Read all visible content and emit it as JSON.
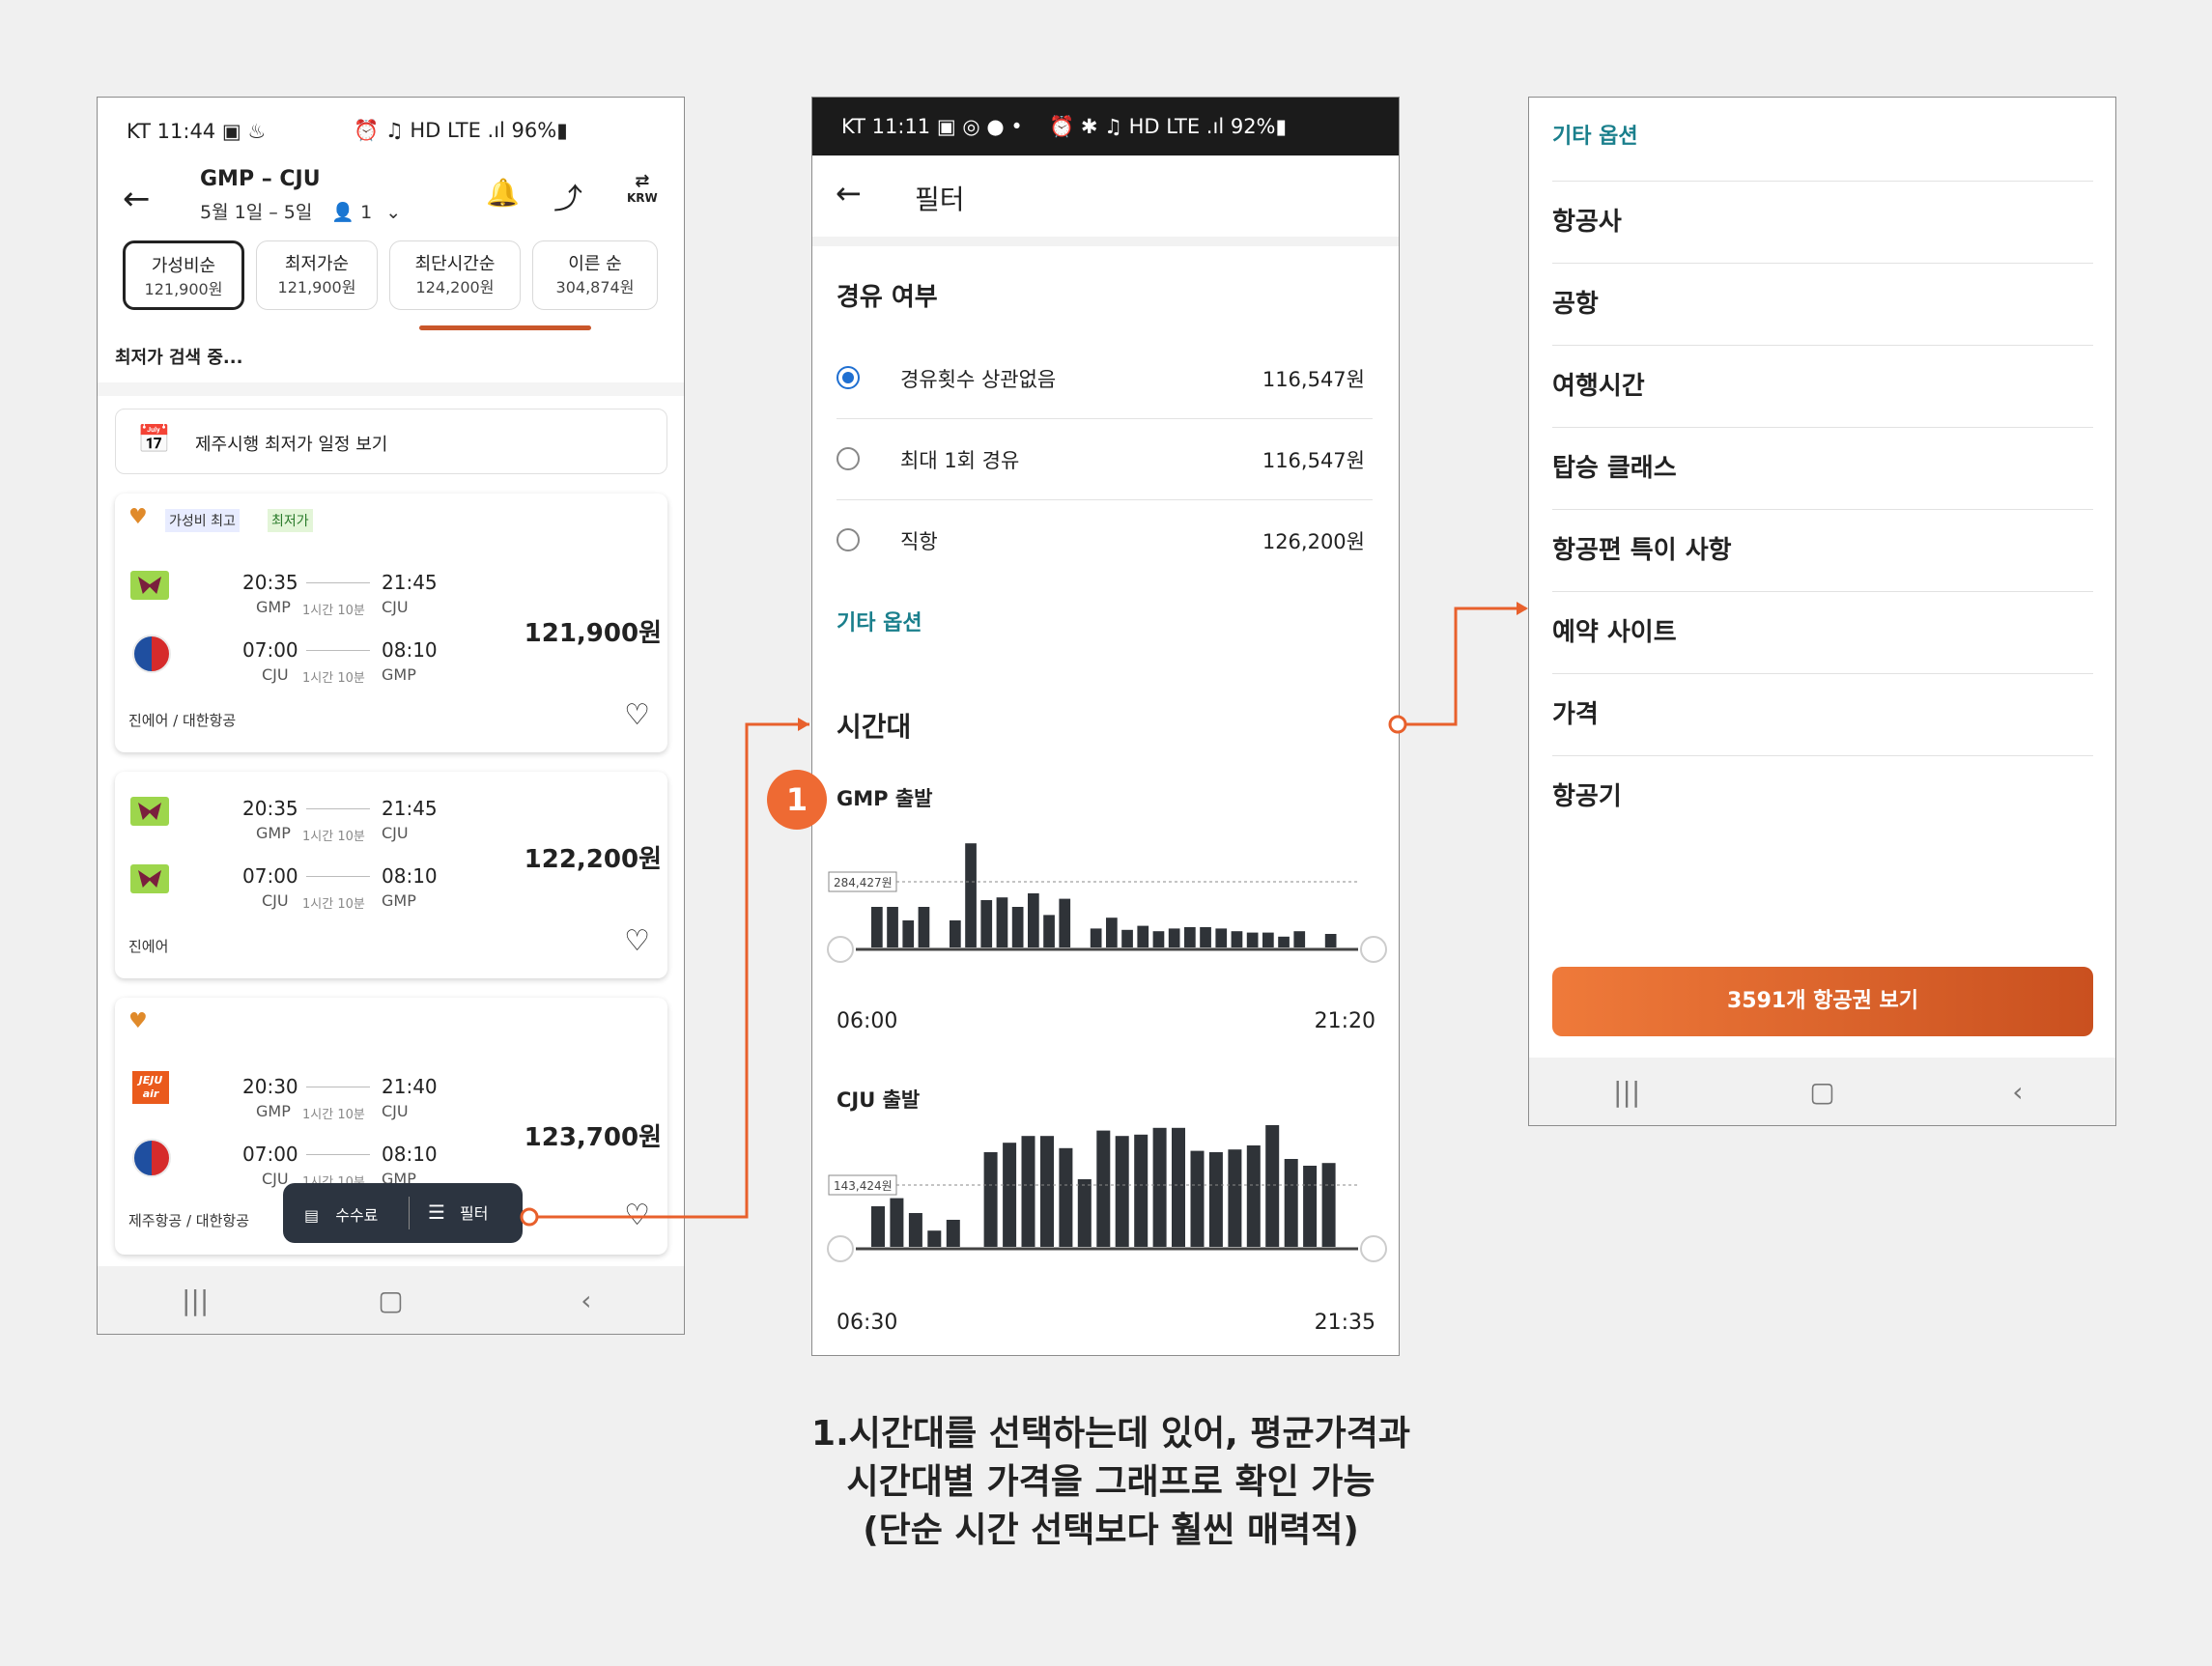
{
  "screen1": {
    "status": {
      "left": "KT 11:44 ▣ ♨",
      "right": "⏰ ♫ HD LTE .ıl 96%▮"
    },
    "route": "GMP – CJU",
    "dates": "5월 1일 – 5일",
    "passengers": "1",
    "currency": "KRW",
    "sort_tabs": [
      {
        "label": "가성비순",
        "price": "121,900원"
      },
      {
        "label": "최저가순",
        "price": "121,900원"
      },
      {
        "label": "최단시간순",
        "price": "124,200원"
      },
      {
        "label": "이른 순",
        "price": "304,874원"
      }
    ],
    "searching": "최저가 검색 중...",
    "calendar_banner": "제주시행 최저가 일정 보기",
    "badges": [
      "가성비 최고",
      "최저가"
    ],
    "cards": [
      {
        "legs": [
          {
            "dep": "20:35",
            "arr": "21:45",
            "from": "GMP",
            "dur": "1시간 10분",
            "to": "CJU"
          },
          {
            "dep": "07:00",
            "arr": "08:10",
            "from": "CJU",
            "dur": "1시간 10분",
            "to": "GMP"
          }
        ],
        "price": "121,900원",
        "airline": "진에어 / 대한항공"
      },
      {
        "legs": [
          {
            "dep": "20:35",
            "arr": "21:45",
            "from": "GMP",
            "dur": "1시간 10분",
            "to": "CJU"
          },
          {
            "dep": "07:00",
            "arr": "08:10",
            "from": "CJU",
            "dur": "1시간 10분",
            "to": "GMP"
          }
        ],
        "price": "122,200원",
        "airline": "진에어"
      },
      {
        "legs": [
          {
            "dep": "20:30",
            "arr": "21:40",
            "from": "GMP",
            "dur": "1시간 10분",
            "to": "CJU"
          },
          {
            "dep": "07:00",
            "arr": "08:10",
            "from": "CJU",
            "dur": "1시간 10분",
            "to": "GMP"
          }
        ],
        "price": "123,700원",
        "airline": "제주항공 / 대한항공"
      }
    ],
    "jeju_logo": "JEJU air",
    "bottom_bar": {
      "fee": "수수료",
      "filter": "필터"
    }
  },
  "screen2": {
    "status": {
      "left": "KT 11:11 ▣ ◎ ● •",
      "right": "⏰ ✱ ♫ HD LTE .ıl 92%▮"
    },
    "title": "필터",
    "stop_heading": "경유 여부",
    "options": [
      {
        "label": "경유횟수 상관없음",
        "price": "116,547원",
        "selected": true
      },
      {
        "label": "최대 1회 경유",
        "price": "116,547원",
        "selected": false
      },
      {
        "label": "직항",
        "price": "126,200원",
        "selected": false
      }
    ],
    "more_options": "기타 옵션",
    "time_heading": "시간대",
    "gmp_label": "GMP 출발",
    "gmp_avg": "284,427원",
    "gmp_start": "06:00",
    "gmp_end": "21:20",
    "cju_label": "CJU 출발",
    "cju_avg": "143,424원",
    "cju_start": "06:30",
    "cju_end": "21:35"
  },
  "screen3": {
    "title": "기타 옵션",
    "items": [
      "항공사",
      "공항",
      "여행시간",
      "탑승 클래스",
      "항공편 특이 사항",
      "예약 사이트",
      "가격",
      "항공기"
    ],
    "cta": "3591개 항공권 보기"
  },
  "annotation": {
    "badge": "1",
    "lines": [
      "1.시간대를 선택하는데 있어, 평균가격과",
      "시간대별 가격을 그래프로 확인 가능",
      "(단순 시간 선택보다 훨씬 매력적)"
    ]
  },
  "chart_data": [
    {
      "type": "bar",
      "title": "GMP 출발",
      "x_range": [
        "06:00",
        "21:20"
      ],
      "average_label": "284,427원",
      "values": [
        30,
        30,
        20,
        30,
        0,
        20,
        77,
        35,
        37,
        30,
        40,
        24,
        36,
        0,
        14,
        22,
        13,
        16,
        12,
        14,
        15,
        15,
        14,
        12,
        11,
        11,
        8,
        12,
        0,
        10
      ]
    },
    {
      "type": "bar",
      "title": "CJU 출발",
      "x_range": [
        "06:30",
        "21:35"
      ],
      "average_label": "143,424원",
      "values": [
        30,
        36,
        25,
        12,
        20,
        0,
        70,
        77,
        82,
        82,
        73,
        50,
        86,
        82,
        83,
        88,
        88,
        71,
        70,
        72,
        75,
        90,
        65,
        60,
        62
      ]
    }
  ]
}
